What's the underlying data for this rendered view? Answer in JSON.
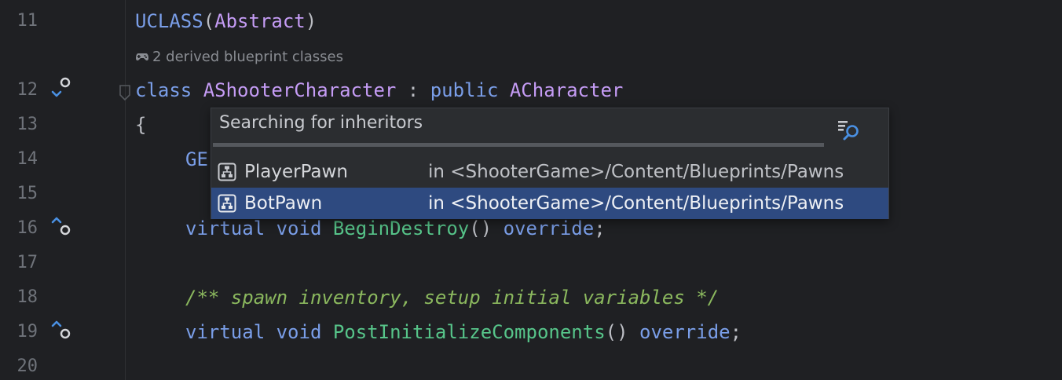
{
  "colors": {
    "background": "#1f2023",
    "line_number": "#6f737a",
    "keyword": "#7a9ee8",
    "type": "#c59cf5",
    "function": "#57c58a",
    "comment": "#8bb85e",
    "popup_bg": "#2b2d30",
    "selection": "#2e4a80"
  },
  "gutter": {
    "line_numbers": [
      "11",
      "12",
      "13",
      "14",
      "15",
      "16",
      "17",
      "18",
      "19",
      "20"
    ]
  },
  "inline_hint": {
    "icon": "gamepad-icon",
    "text": "2 derived blueprint classes"
  },
  "code": {
    "l11_macro": "UCLASS",
    "l11_open": "(",
    "l11_arg": "Abstract",
    "l11_close": ")",
    "l12_kw1": "class",
    "l12_type": "AShooterCharacter",
    "l12_colon": " : ",
    "l12_kw2": "public",
    "l12_base": "ACharacter",
    "l13_brace": "{",
    "l14_partial": "GE",
    "l16_kw1": "virtual",
    "l16_kw2": "void",
    "l16_fn": "BeginDestroy",
    "l16_parens": "()",
    "l16_kw3": "override",
    "l16_semi": ";",
    "l18_comment": "/** spawn inventory, setup initial variables */",
    "l19_kw1": "virtual",
    "l19_kw2": "void",
    "l19_fn": "PostInitializeComponents",
    "l19_parens": "()",
    "l19_kw3": "override",
    "l19_semi": ";"
  },
  "popup": {
    "title": "Searching for inheritors",
    "find_icon": "find-usages-icon",
    "results": [
      {
        "icon": "blueprint-icon",
        "name": "PlayerPawn",
        "location": "in <ShooterGame>/Content/Blueprints/Pawns",
        "selected": false
      },
      {
        "icon": "blueprint-icon",
        "name": "BotPawn",
        "location": "in <ShooterGame>/Content/Blueprints/Pawns",
        "selected": true
      }
    ]
  }
}
